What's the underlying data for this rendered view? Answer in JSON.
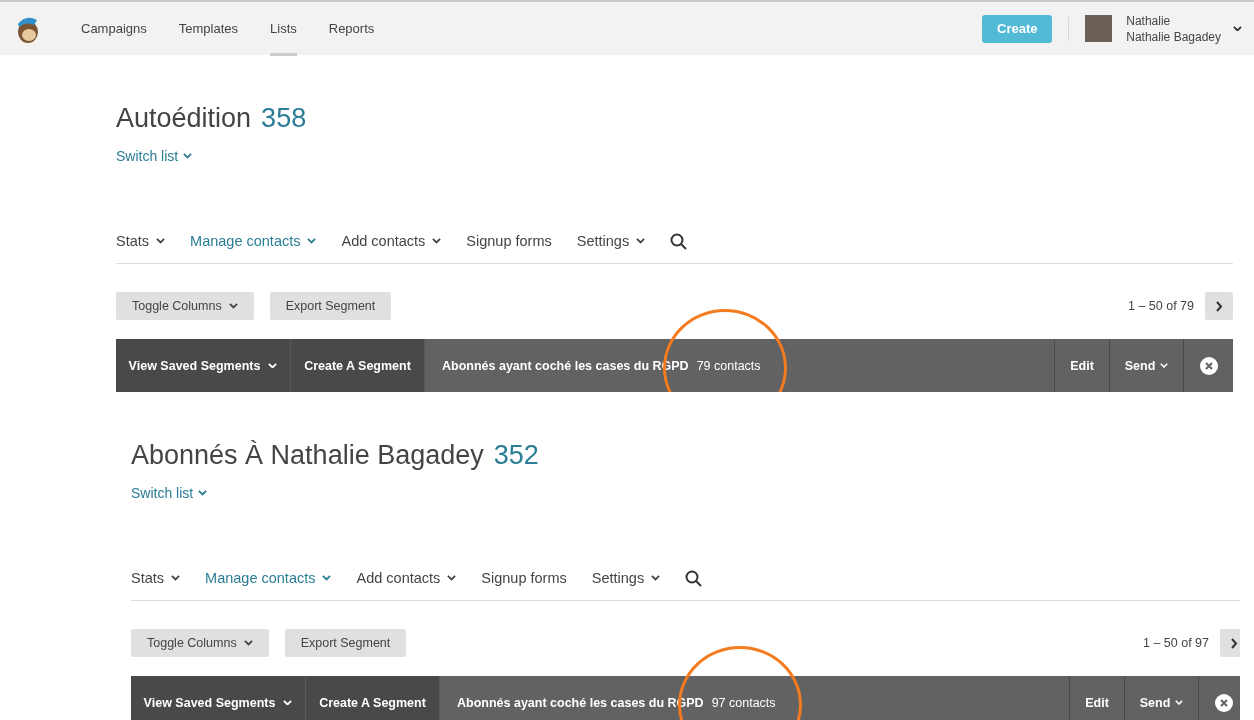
{
  "nav": {
    "items": [
      {
        "label": "Campaigns",
        "selected": false
      },
      {
        "label": "Templates",
        "selected": false
      },
      {
        "label": "Lists",
        "selected": true
      },
      {
        "label": "Reports",
        "selected": false
      }
    ],
    "create_button": "Create",
    "user": {
      "name": "Nathalie",
      "account": "Nathalie Bagadey"
    }
  },
  "lists": [
    {
      "title": "Autoédition",
      "count": "358",
      "switch_label": "Switch list",
      "tabs": [
        {
          "label": "Stats",
          "selected": false,
          "dropdown": true
        },
        {
          "label": "Manage contacts",
          "selected": true,
          "dropdown": true
        },
        {
          "label": "Add contacts",
          "selected": false,
          "dropdown": true
        },
        {
          "label": "Signup forms",
          "selected": false,
          "dropdown": false
        },
        {
          "label": "Settings",
          "selected": false,
          "dropdown": true
        }
      ],
      "toggle_button": "Toggle Columns",
      "export_button": "Export Segment",
      "pager": "1 – 50 of 79",
      "segment_bar": {
        "view_saved": "View Saved Segments",
        "create": "Create A Segment",
        "segment_name": "Abonnés ayant coché les cases du RGPD",
        "contacts": "79 contacts",
        "edit": "Edit",
        "send": "Send"
      }
    },
    {
      "title": "Abonnés À Nathalie Bagadey",
      "count": "352",
      "switch_label": "Switch list",
      "tabs": [
        {
          "label": "Stats",
          "selected": false,
          "dropdown": true
        },
        {
          "label": "Manage contacts",
          "selected": true,
          "dropdown": true
        },
        {
          "label": "Add contacts",
          "selected": false,
          "dropdown": true
        },
        {
          "label": "Signup forms",
          "selected": false,
          "dropdown": false
        },
        {
          "label": "Settings",
          "selected": false,
          "dropdown": true
        }
      ],
      "toggle_button": "Toggle Columns",
      "export_button": "Export Segment",
      "pager": "1 – 50 of 97",
      "segment_bar": {
        "view_saved": "View Saved Segments",
        "create": "Create A Segment",
        "segment_name": "Abonnés ayant coché les cases du RGPD",
        "contacts": "97 contacts",
        "edit": "Edit",
        "send": "Send"
      }
    }
  ]
}
